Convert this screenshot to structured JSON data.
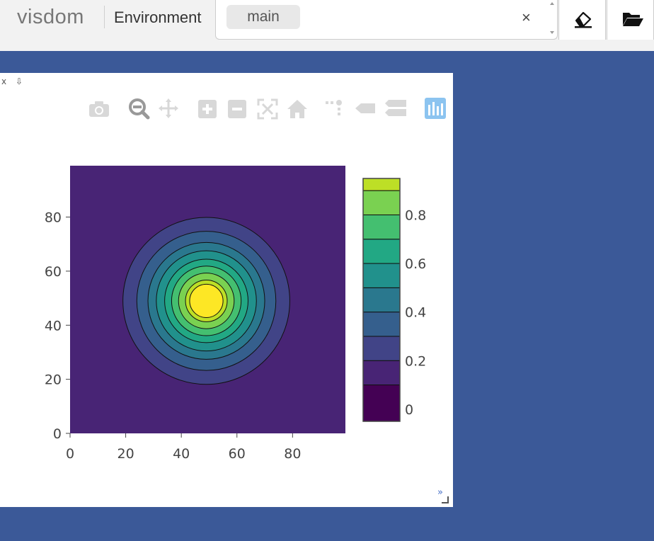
{
  "navbar": {
    "brand": "visdom",
    "env_label": "Environment",
    "env_selected": "main",
    "clear_symbol": "×",
    "buttons": [
      {
        "name": "clear-env-button",
        "icon": "eraser-icon"
      },
      {
        "name": "manage-env-button",
        "icon": "folder-open-icon"
      }
    ]
  },
  "pane": {
    "close_symbol": "x",
    "pin_symbol": "⇩",
    "toolbar_icons": [
      "camera-icon",
      "zoom-icon",
      "pan-icon",
      "zoom-in-icon",
      "zoom-out-icon",
      "autoscale-icon",
      "reset-axes-icon",
      "spike-lines-icon",
      "hover-closest-icon",
      "hover-compare-icon",
      "plotly-logo-icon"
    ],
    "expand_symbol": "»"
  },
  "colors": {
    "background": "#3b5998",
    "navbar": "#f2f2f2"
  },
  "chart_data": {
    "type": "heatmap",
    "subtype": "contour",
    "description_function": "gaussian bump centered near (49,49)",
    "x_range": [
      0,
      99
    ],
    "y_range": [
      0,
      99
    ],
    "xticks": [
      "0",
      "20",
      "40",
      "60",
      "80"
    ],
    "yticks": [
      "0",
      "20",
      "40",
      "60",
      "80"
    ],
    "center": [
      49,
      49
    ],
    "contour_levels": [
      0.1,
      0.2,
      0.3,
      0.4,
      0.5,
      0.6,
      0.7,
      0.8,
      0.9
    ],
    "contour_radii": [
      30,
      25,
      21,
      18,
      15,
      12.5,
      10,
      7.5,
      6
    ],
    "colorbar_ticks": [
      "0",
      "0.2",
      "0.4",
      "0.6",
      "0.8"
    ],
    "colorbar_range": [
      -0.05,
      0.95
    ],
    "colorscale": [
      "#440154",
      "#482475",
      "#414487",
      "#355f8d",
      "#2a788e",
      "#21918c",
      "#22a884",
      "#44bf70",
      "#7ad151",
      "#bddf26",
      "#fde725"
    ],
    "grid": false,
    "legend": "right"
  }
}
